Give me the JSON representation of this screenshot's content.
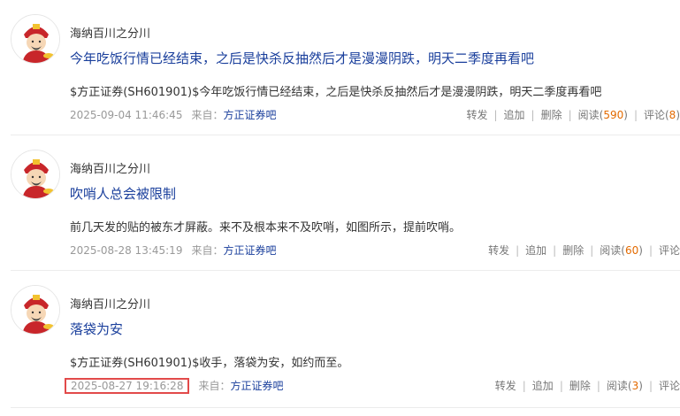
{
  "posts": [
    {
      "author": "海纳百川之分川",
      "title": "今年吃饭行情已经结束，之后是快杀反抽然后才是漫漫阴跌，明天二季度再看吧",
      "body": "$方正证券(SH601901)$今年吃饭行情已经结束，之后是快杀反抽然后才是漫漫阴跌，明天二季度再看吧",
      "time": "2025-09-04 11:46:45",
      "from_label": "来自：",
      "source": "方正证券吧",
      "actions": {
        "repost": "转发",
        "append": "追加",
        "delete": "删除",
        "read_label": "阅读(",
        "read_count": "590",
        "read_close": ")",
        "comment_label": "评论(",
        "comment_count": "8",
        "comment_close": ")"
      }
    },
    {
      "author": "海纳百川之分川",
      "title": "吹哨人总会被限制",
      "body": "前几天发的贴的被东才屏蔽。来不及根本来不及吹哨，如图所示，提前吹哨。",
      "time": "2025-08-28 13:45:19",
      "from_label": "来自：",
      "source": "方正证券吧",
      "actions": {
        "repost": "转发",
        "append": "追加",
        "delete": "删除",
        "read_label": "阅读(",
        "read_count": "60",
        "read_close": ")",
        "comment_label": "评论",
        "comment_count": "",
        "comment_close": ""
      }
    },
    {
      "author": "海纳百川之分川",
      "title": "落袋为安",
      "body": "$方正证券(SH601901)$收手，落袋为安，如约而至。",
      "time": "2025-08-27 19:16:28",
      "from_label": "来自：",
      "source": "方正证券吧",
      "actions": {
        "repost": "转发",
        "append": "追加",
        "delete": "删除",
        "read_label": "阅读(",
        "read_count": "3",
        "read_close": ")",
        "comment_label": "评论",
        "comment_count": "",
        "comment_close": ""
      }
    }
  ],
  "colors": {
    "title": "#1a3f9c",
    "count": "#e36a00",
    "highlight_box": "#e24a4a"
  },
  "icons": {
    "avatar": "caishen-avatar-icon"
  }
}
